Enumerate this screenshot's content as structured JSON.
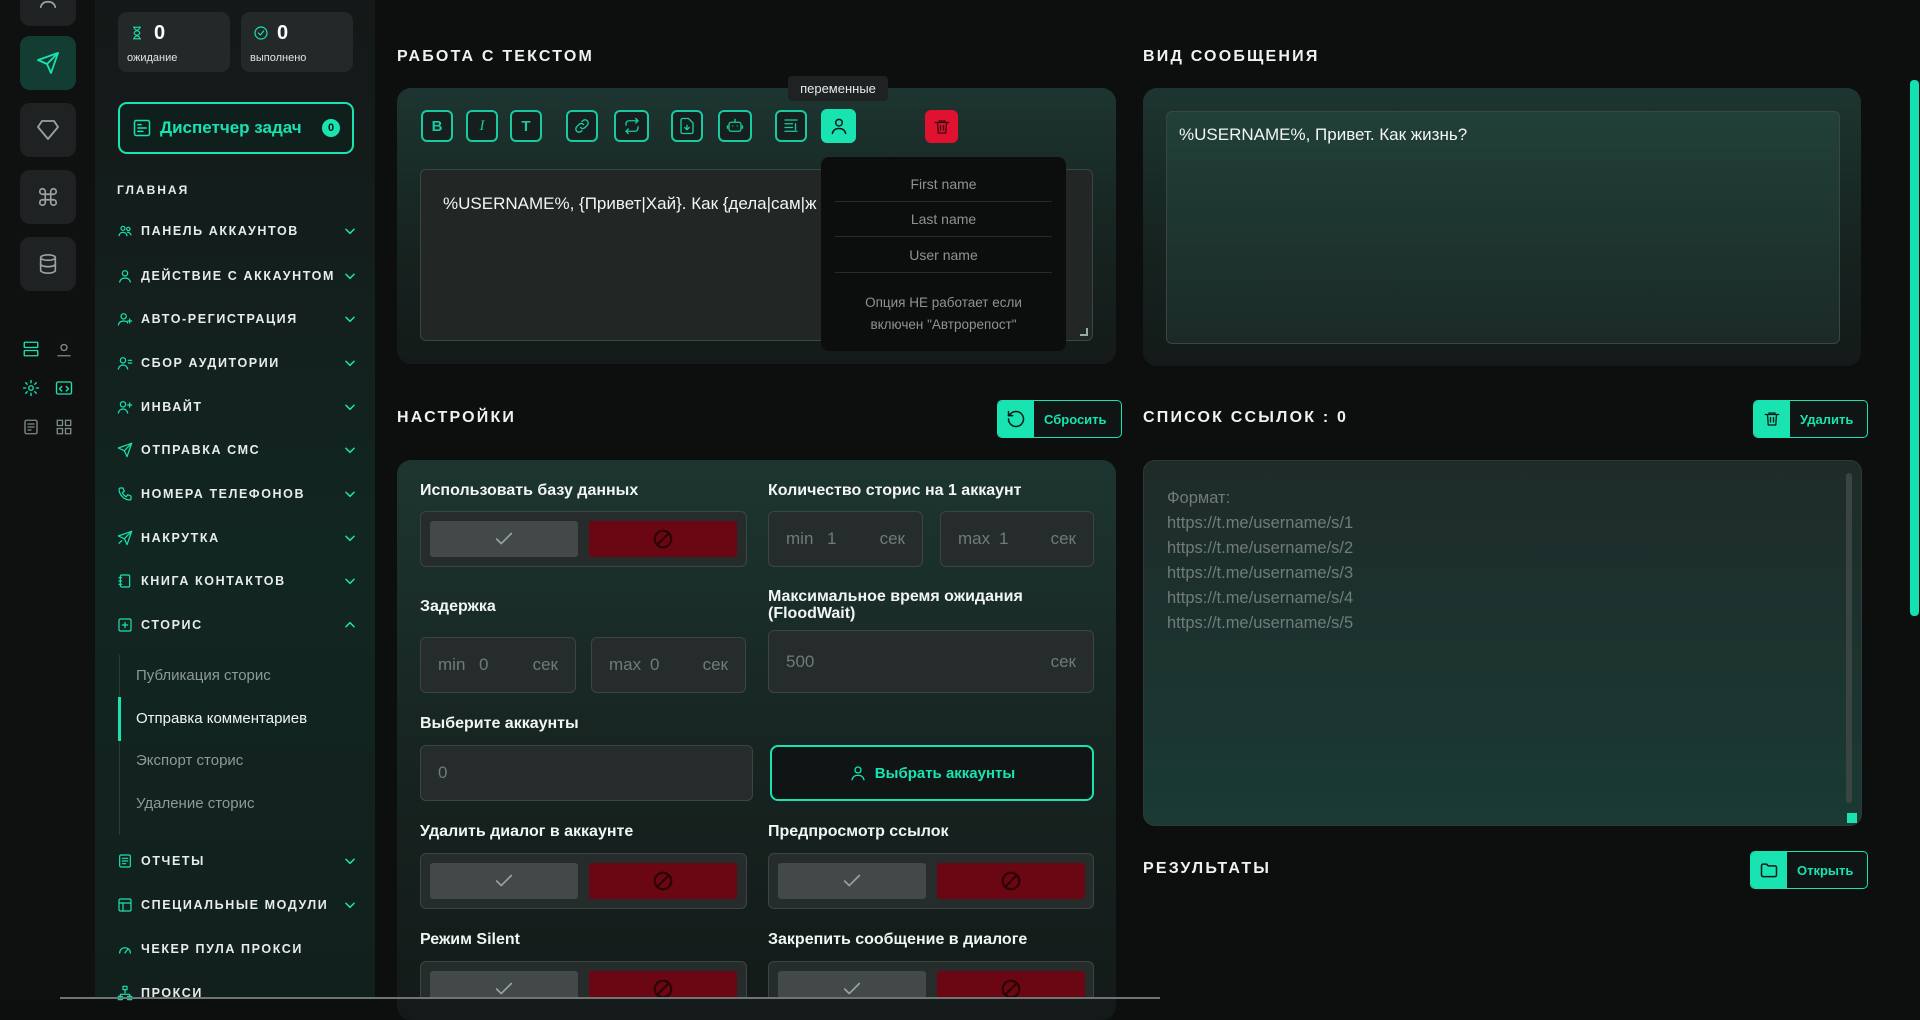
{
  "stats": {
    "pending_value": "0",
    "pending_label": "ожидание",
    "done_value": "0",
    "done_label": "выполнено"
  },
  "task_manager": {
    "label": "Диспетчер задач",
    "count": "0"
  },
  "sidebar": {
    "section": "ГЛАВНАЯ",
    "items": [
      {
        "label": "ПАНЕЛЬ АККАУНТОВ",
        "icon": "users-icon"
      },
      {
        "label": "ДЕЙСТВИЕ С АККАУНТОМ",
        "icon": "user-icon"
      },
      {
        "label": "АВТО-РЕГИСТРАЦИЯ",
        "icon": "user-plus-icon"
      },
      {
        "label": "СБОР АУДИТОРИИ",
        "icon": "user-list-icon"
      },
      {
        "label": "ИНВАЙТ",
        "icon": "user-add-icon"
      },
      {
        "label": "ОТПРАВКА СМС",
        "icon": "send-icon"
      },
      {
        "label": "НОМЕРА ТЕЛЕФОНОВ",
        "icon": "phone-icon"
      },
      {
        "label": "НАКРУТКА",
        "icon": "boost-icon"
      },
      {
        "label": "КНИГА КОНТАКТОВ",
        "icon": "book-icon"
      },
      {
        "label": "СТОРИС",
        "icon": "plus-square-icon"
      }
    ],
    "stories_sub": [
      "Публикация сторис",
      "Отправка комментариев",
      "Экспорт сторис",
      "Удаление сторис"
    ],
    "items2": [
      {
        "label": "ОТЧЕТЫ",
        "icon": "report-icon"
      },
      {
        "label": "СПЕЦИАЛЬНЫЕ МОДУЛИ",
        "icon": "modules-icon"
      },
      {
        "label": "ЧЕКЕР ПУЛА ПРОКСИ",
        "icon": "gauge-icon"
      },
      {
        "label": "ПРОКСИ",
        "icon": "network-icon"
      }
    ]
  },
  "text_section": {
    "title": "РАБОТА С ТЕКСТОМ",
    "toolbar": [
      "B",
      "I",
      "T"
    ],
    "tooltip": "переменные",
    "text_value": "%USERNAME%, {Привет|Хай}. Как {дела|сам|ж"
  },
  "variables_popup": {
    "items": [
      "First name",
      "Last name",
      "User name"
    ],
    "note_line1": "Опция НЕ работает если",
    "note_line2": "включен \"Автрорепост\""
  },
  "preview": {
    "title": "ВИД СООБЩЕНИЯ",
    "text": "%USERNAME%, Привет. Как жизнь?"
  },
  "settings": {
    "title": "НАСТРОЙКИ",
    "reset": "Сбросить",
    "use_db": "Использовать базу данных",
    "stories_count": "Количество сторис на 1 аккаунт",
    "min": "min",
    "max": "max",
    "sec": "сек",
    "stories_min": "1",
    "stories_max": "1",
    "delay": "Задержка",
    "delay_min": "0",
    "delay_max": "0",
    "floodwait_line1": "Максимальное время ожидания",
    "floodwait_line2": "(FloodWait)",
    "floodwait_value": "500",
    "choose_accounts": "Выберите аккаунты",
    "accounts_count": "0",
    "choose_btn": "Выбрать аккаунты",
    "delete_dialog": "Удалить диалог в аккаунте",
    "link_preview": "Предпросмотр ссылок",
    "silent": "Режим Silent",
    "pin": "Закрепить сообщение в диалоге"
  },
  "links": {
    "title": "СПИСОК ССЫЛОК : 0",
    "delete": "Удалить",
    "placeholder_lines": [
      "Формат:",
      "https://t.me/username/s/1",
      "https://t.me/username/s/2",
      "https://t.me/username/s/3",
      "https://t.me/username/s/4",
      "https://t.me/username/s/5"
    ]
  },
  "results": {
    "title": "РЕЗУЛЬТАТЫ",
    "open": "Открыть"
  },
  "colors": {
    "accent": "#19e3b1",
    "danger": "#e0122f",
    "background": "#0d0f0f"
  }
}
